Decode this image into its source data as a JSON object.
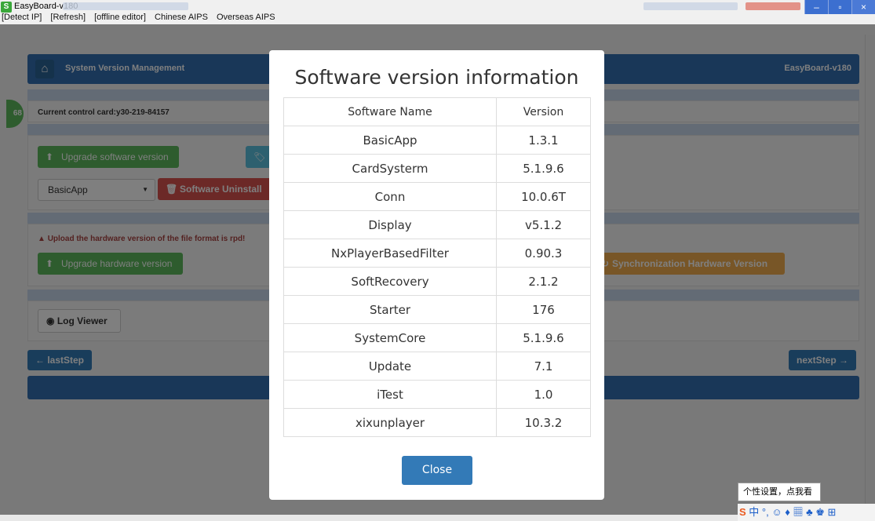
{
  "window": {
    "app_icon": "S",
    "title": "EasyBoard-v180",
    "min": "–",
    "max": "▫",
    "close": "×"
  },
  "menu": [
    "[Detect IP]",
    "[Refresh]",
    "[offline editor]",
    "Chinese AIPS",
    "Overseas AIPS"
  ],
  "header": {
    "home_icon": "⌂",
    "title": "System Version Management",
    "right_title": "EasyBoard-v180"
  },
  "side_badge": "68",
  "card": {
    "label": "Current control card:y30-219-84157"
  },
  "software": {
    "upgrade_label": "Upgrade software version",
    "select_value": "BasicApp",
    "uninstall_label": "Software Uninstall"
  },
  "hardware": {
    "warning": "Upload the hardware version of the file format is rpd!",
    "upgrade_label": "Upgrade hardware version",
    "sync_label": "Synchronization Hardware Version"
  },
  "log": {
    "label": "Log Viewer"
  },
  "nav": {
    "last": "← lastStep",
    "next": "nextStep →"
  },
  "modal": {
    "title": "Software version information",
    "columns": [
      "Software Name",
      "Version"
    ],
    "rows": [
      [
        "BasicApp",
        "1.3.1"
      ],
      [
        "CardSysterm",
        "5.1.9.6"
      ],
      [
        "Conn",
        "10.0.6T"
      ],
      [
        "Display",
        "v5.1.2"
      ],
      [
        "NxPlayerBasedFilter",
        "0.90.3"
      ],
      [
        "SoftRecovery",
        "2.1.2"
      ],
      [
        "Starter",
        "176"
      ],
      [
        "SystemCore",
        "5.1.9.6"
      ],
      [
        "Update",
        "7.1"
      ],
      [
        "iTest",
        "1.0"
      ],
      [
        "xixunplayer",
        "10.3.2"
      ]
    ],
    "close_label": "Close"
  },
  "ime": {
    "tooltip": "个性设置，点我看看",
    "bar": "中 °, ☺ ♦ ▦ ♣ ♚ ⊞"
  }
}
